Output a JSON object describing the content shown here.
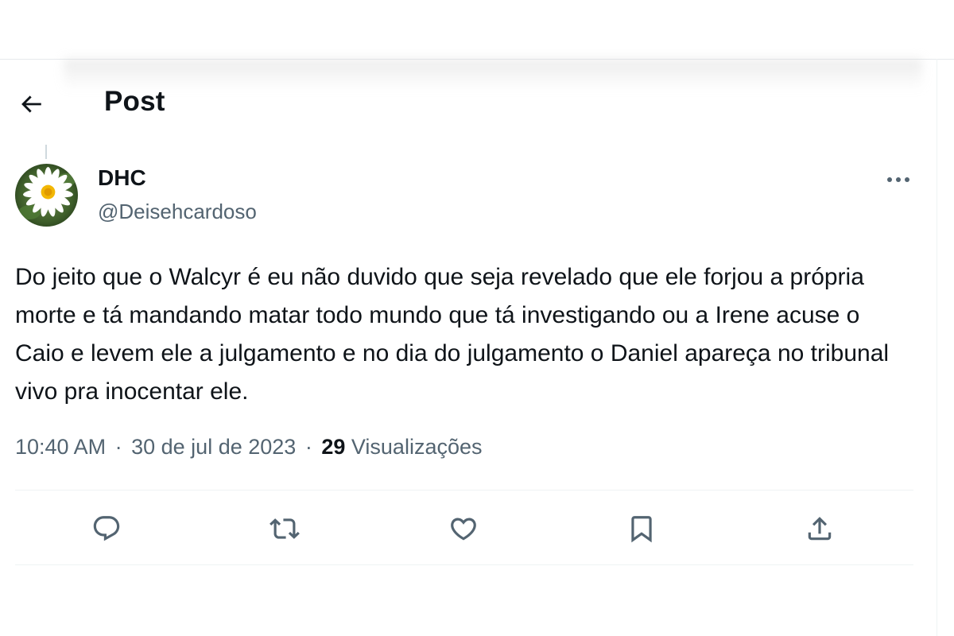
{
  "header": {
    "title": "Post",
    "back_icon": "arrow-left-icon"
  },
  "post": {
    "author": {
      "display_name": "DHC",
      "handle": "@Deisehcardoso",
      "avatar_icon": "daisy-avatar"
    },
    "text": "Do jeito que o Walcyr é eu não duvido que seja revelado que ele forjou a própria morte e tá mandando matar todo mundo que tá investigando ou a Irene acuse o Caio e levem ele a julgamento e no dia do julgamento o Daniel apareça no tribunal vivo pra inocentar ele.",
    "time": "10:40 AM",
    "date": "30 de jul de 2023",
    "separator": "·",
    "views_count": "29",
    "views_label": "Visualizações"
  },
  "actions": [
    {
      "name": "reply",
      "icon": "reply-icon"
    },
    {
      "name": "repost",
      "icon": "repost-icon"
    },
    {
      "name": "like",
      "icon": "heart-icon"
    },
    {
      "name": "bookmark",
      "icon": "bookmark-icon"
    },
    {
      "name": "share",
      "icon": "share-icon"
    }
  ],
  "colors": {
    "text_primary": "#0f1419",
    "text_secondary": "#536471",
    "divider": "#eff3f4"
  }
}
